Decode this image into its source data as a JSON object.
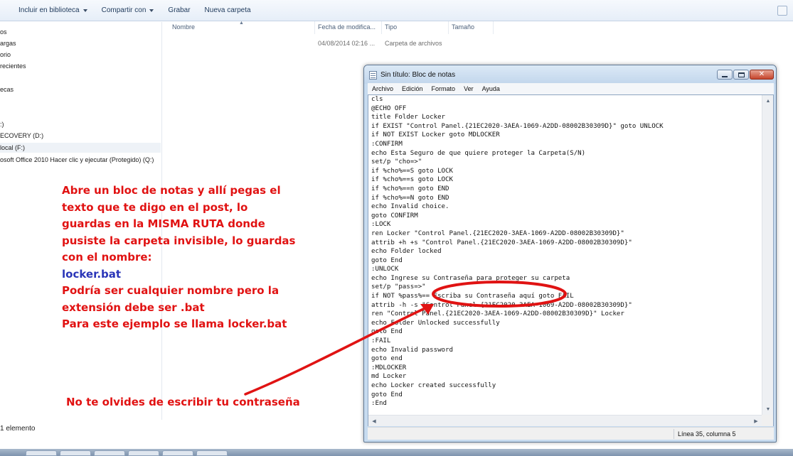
{
  "toolbar": {
    "include_library": "Incluir en biblioteca",
    "share_with": "Compartir con",
    "burn": "Grabar",
    "new_folder": "Nueva carpeta"
  },
  "nav": {
    "items": [
      "os",
      "argas",
      "orio",
      "recientes",
      "ecas",
      ":)",
      "ECOVERY (D:)",
      "local (F:)",
      "osoft Office 2010 Hacer clic y ejecutar (Protegido) (Q:)"
    ]
  },
  "columns": {
    "name": "Nombre",
    "modified": "Fecha de modifica...",
    "type": "Tipo",
    "size": "Tamaño"
  },
  "row": {
    "modified": "04/08/2014 02:16 ...",
    "type": "Carpeta de archivos"
  },
  "status": {
    "count": "1 elemento"
  },
  "annotations": {
    "instructions": [
      "Abre un bloc de notas y allí pegas el",
      "texto que te digo en el post, lo",
      "guardas en la MISMA RUTA donde",
      "pusiste la carpeta invisible, lo guardas",
      "con el nombre:"
    ],
    "filename": "locker.bat",
    "note": [
      "Podría ser cualquier nombre pero la",
      "extensión debe ser .bat",
      "Para este ejemplo se llama locker.bat"
    ],
    "password_reminder": "No te olvides de escribir tu contraseña"
  },
  "notepad": {
    "title": "Sin título: Bloc de notas",
    "menu": [
      "Archivo",
      "Edición",
      "Formato",
      "Ver",
      "Ayuda"
    ],
    "lines": [
      "cls",
      "@ECHO OFF",
      "title Folder Locker",
      "if EXIST \"Control Panel.{21EC2020-3AEA-1069-A2DD-08002B30309D}\" goto UNLOCK",
      "if NOT EXIST Locker goto MDLOCKER",
      ":CONFIRM",
      "echo Esta Seguro de que quiere proteger la Carpeta(S/N)",
      "set/p \"cho=>\"",
      "if %cho%==S goto LOCK",
      "if %cho%==s goto LOCK",
      "if %cho%==n goto END",
      "if %cho%==N goto END",
      "echo Invalid choice.",
      "goto CONFIRM",
      ":LOCK",
      "ren Locker \"Control Panel.{21EC2020-3AEA-1069-A2DD-08002B30309D}\"",
      "attrib +h +s \"Control Panel.{21EC2020-3AEA-1069-A2DD-08002B30309D}\"",
      "echo Folder locked",
      "goto End",
      ":UNLOCK",
      "echo Ingrese su Contraseña para proteger su carpeta",
      "set/p \"pass=>\"",
      "if NOT %pass%== Escriba su Contraseña aquí goto FAIL",
      "attrib -h -s \"Control Panel.{21EC2020-3AEA-1069-A2DD-08002B30309D}\"",
      "ren \"Control Panel.{21EC2020-3AEA-1069-A2DD-08002B30309D}\" Locker",
      "echo Folder Unlocked successfully",
      "goto End",
      ":FAIL",
      "echo Invalid password",
      "goto end",
      ":MDLOCKER",
      "md Locker",
      "echo Locker created successfully",
      "goto End",
      ":End"
    ],
    "status": "Línea 35, columna 5"
  }
}
